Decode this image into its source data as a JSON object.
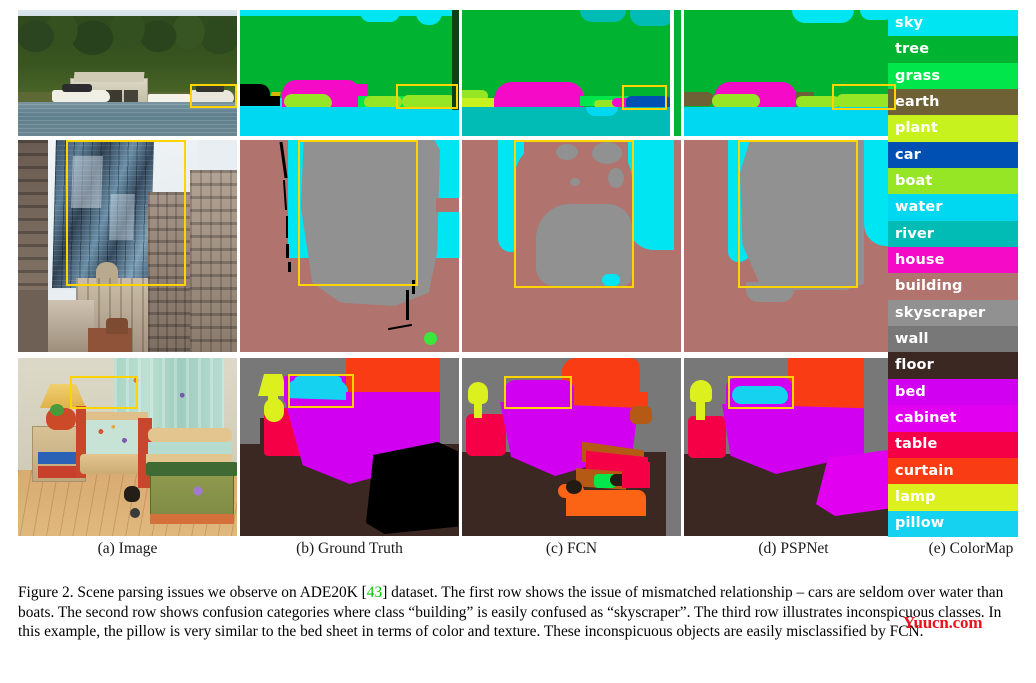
{
  "figure": {
    "caption_label": "Figure 2.",
    "caption_text": " Scene parsing issues we observe on ADE20K [43] dataset. The first row shows the issue of mismatched relationship – cars are seldom over water than boats. The second row shows confusion categories where class “building” is easily confused as “skyscraper”. The third row illustrates inconspicuous classes. In this example, the pillow is very similar to the bed sheet in terms of color and texture. These inconspicuous objects are easily misclassified by FCN.",
    "caption_part1": " Scene parsing issues we observe on ADE20K [",
    "reference": "43",
    "caption_part2": "] dataset. The first row shows the issue of mismatched relationship – cars are seldom over water than boats. The second row shows confusion categories where class “building” is easily confused as “skyscraper”. The third row illustrates inconspicuous classes. In this example, the pillow is very similar to the bed sheet in terms of color and texture. These inconspicuous objects are easily misclassified by FCN.",
    "watermark": "Yuucn.com"
  },
  "columns": [
    {
      "label": "(a) Image"
    },
    {
      "label": "(b) Ground Truth"
    },
    {
      "label": "(c) FCN"
    },
    {
      "label": "(d) PSPNet"
    },
    {
      "label": "(e) ColorMap"
    }
  ],
  "colormap": {
    "title": "(e) ColorMap",
    "entries": [
      {
        "label": "sky",
        "color": "#00e5f2"
      },
      {
        "label": "tree",
        "color": "#00b432"
      },
      {
        "label": "grass",
        "color": "#00e64b"
      },
      {
        "label": "earth",
        "color": "#6e6135"
      },
      {
        "label": "plant",
        "color": "#c8f21e"
      },
      {
        "label": "car",
        "color": "#0050b4"
      },
      {
        "label": "boat",
        "color": "#96e626"
      },
      {
        "label": "water",
        "color": "#00d7f0"
      },
      {
        "label": "river",
        "color": "#00bcb4"
      },
      {
        "label": "house",
        "color": "#f50ac8"
      },
      {
        "label": "building",
        "color": "#b0736e"
      },
      {
        "label": "skyscraper",
        "color": "#919191"
      },
      {
        "label": "wall",
        "color": "#787878"
      },
      {
        "label": "floor",
        "color": "#3c2823"
      },
      {
        "label": "bed",
        "color": "#d200f0"
      },
      {
        "label": "cabinet",
        "color": "#e100f0"
      },
      {
        "label": "table",
        "color": "#f50046"
      },
      {
        "label": "curtain",
        "color": "#fa3c14"
      },
      {
        "label": "lamp",
        "color": "#dcf01e"
      },
      {
        "label": "pillow",
        "color": "#14d2f0"
      }
    ]
  },
  "rows": [
    {
      "name": "boathouse-scene",
      "issue": "mismatched relationship",
      "cells": [
        {
          "kind": "photo",
          "subject": "boathouse on lake with boats"
        },
        {
          "kind": "segmentation",
          "model": "Ground Truth",
          "highlight_label": "boat"
        },
        {
          "kind": "segmentation",
          "model": "FCN",
          "highlight_label": "car"
        },
        {
          "kind": "segmentation",
          "model": "PSPNet",
          "highlight_label": "boat"
        }
      ]
    },
    {
      "name": "skyscraper-scene",
      "issue": "confusion categories",
      "cells": [
        {
          "kind": "photo",
          "subject": "glass skyscraper between older buildings"
        },
        {
          "kind": "segmentation",
          "model": "Ground Truth",
          "highlight_label": "skyscraper"
        },
        {
          "kind": "segmentation",
          "model": "FCN",
          "highlight_label": "building"
        },
        {
          "kind": "segmentation",
          "model": "PSPNet",
          "highlight_label": "skyscraper"
        }
      ]
    },
    {
      "name": "bedroom-scene",
      "issue": "inconspicuous classes",
      "cells": [
        {
          "kind": "photo",
          "subject": "child bedroom with bed, lamp, toy chest"
        },
        {
          "kind": "segmentation",
          "model": "Ground Truth",
          "highlight_label": "pillow"
        },
        {
          "kind": "segmentation",
          "model": "FCN",
          "highlight_label": "bed"
        },
        {
          "kind": "segmentation",
          "model": "PSPNet",
          "highlight_label": "pillow"
        }
      ]
    }
  ]
}
